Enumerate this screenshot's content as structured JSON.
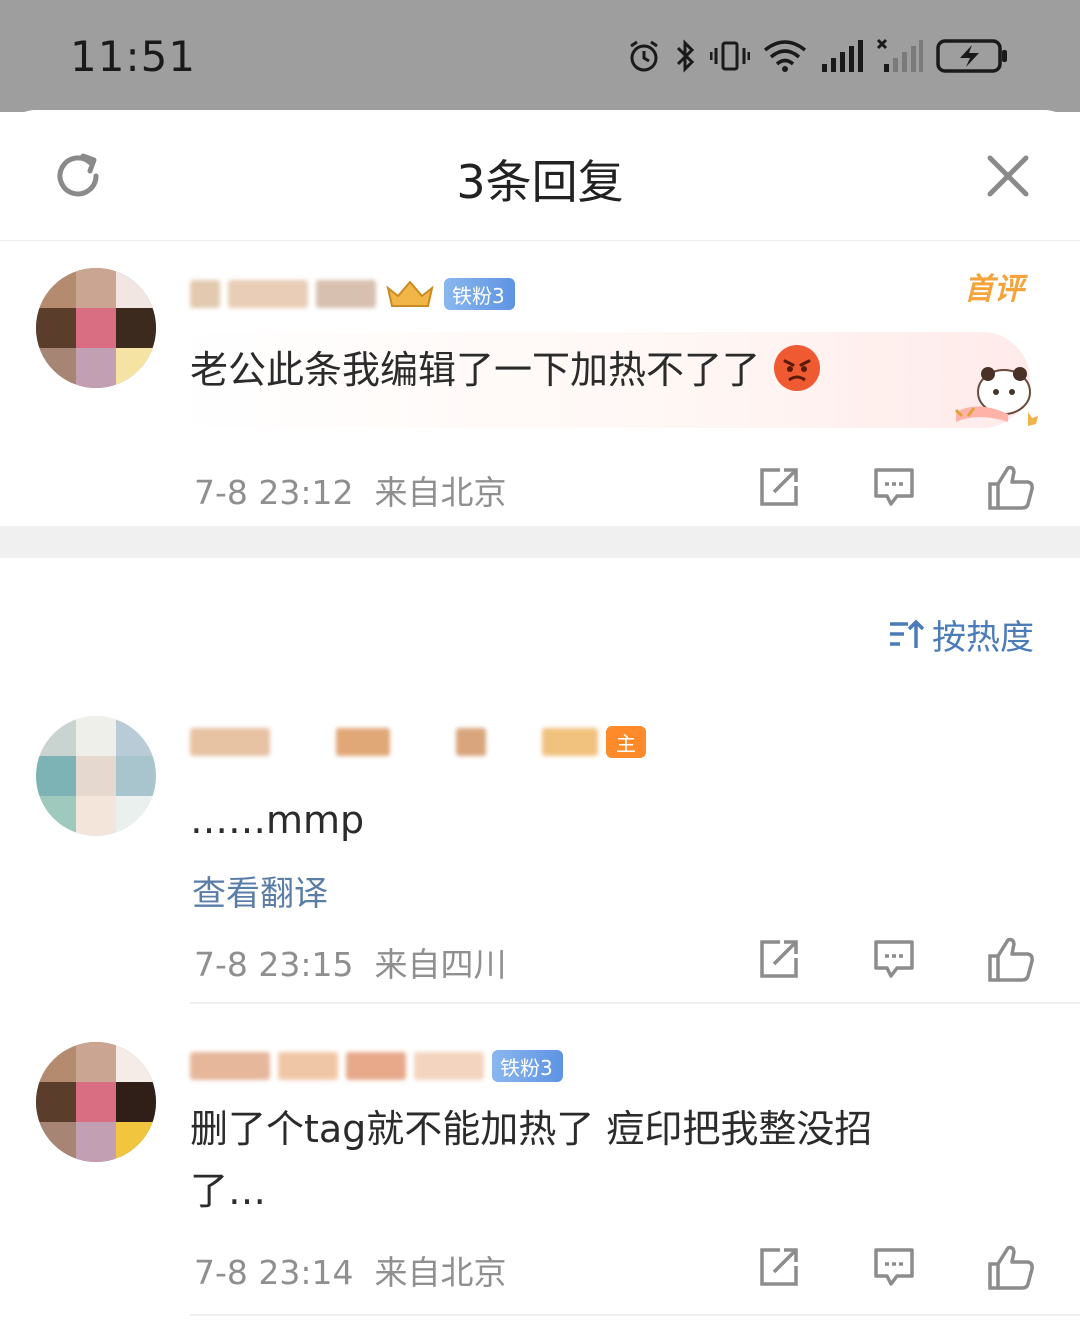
{
  "status_bar": {
    "time": "11:51"
  },
  "sheet": {
    "title": "3条回复"
  },
  "root_comment": {
    "badge_fan": "铁粉3",
    "badge_first": "首评",
    "text": "老公此条我编辑了一下加热不了了",
    "emoji": "angry-face",
    "timestamp": "7-8 23:12",
    "location": "来自北京"
  },
  "sort": {
    "label": "按热度"
  },
  "replies": [
    {
      "badge_host": "主",
      "text": "……mmp",
      "translate_label": "查看翻译",
      "timestamp": "7-8 23:15",
      "location": "来自四川"
    },
    {
      "badge_fan": "铁粉3",
      "text_line1": "删了个tag就不能加热了 痘印把我整没招",
      "text_line2": "了…",
      "timestamp": "7-8 23:14",
      "location": "来自北京"
    }
  ],
  "colors": {
    "status_bg": "#9e9e9e",
    "link_blue": "#4b7cb8",
    "first_badge": "#f5a33b",
    "host_badge": "#ff8a2a"
  }
}
